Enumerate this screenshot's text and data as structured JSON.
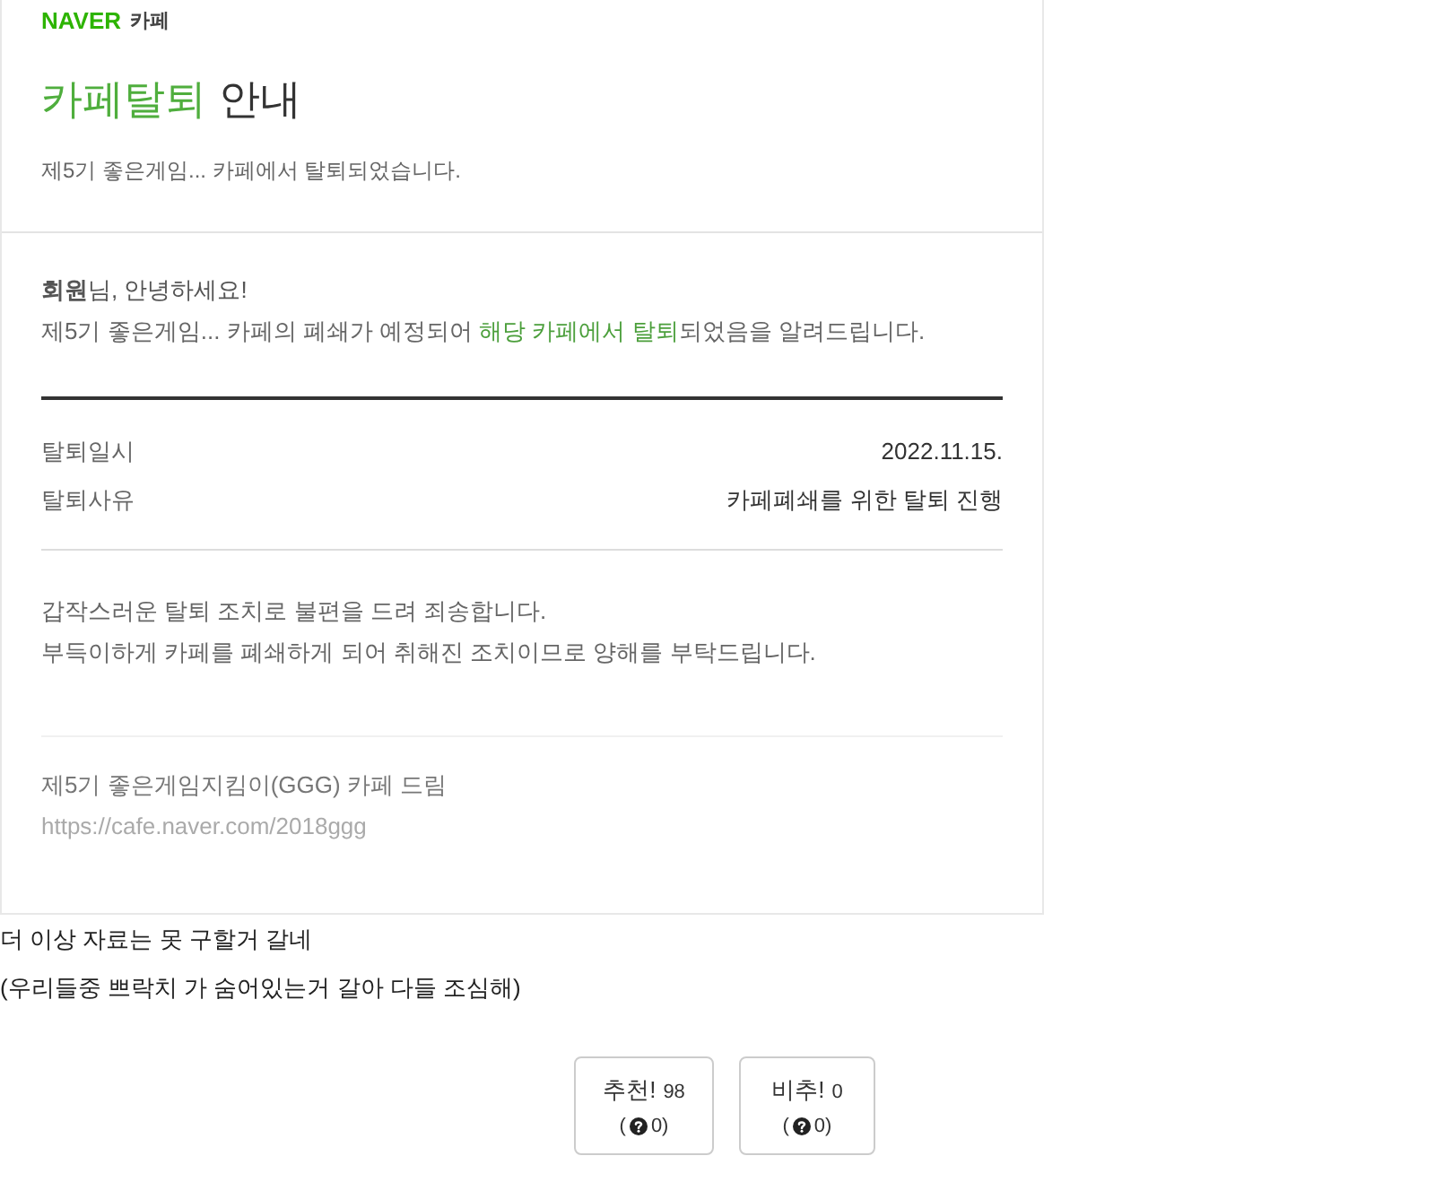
{
  "notice": {
    "logo": {
      "brand": "NAVER",
      "service": "카페"
    },
    "title": {
      "highlight": "카페탈퇴",
      "rest": "안내"
    },
    "summary": "제5기 좋은게임... 카페에서 탈퇴되었습니다.",
    "greeting": "**회원**님, 안녕하세요!",
    "message": [
      {
        "text": "제5기 좋은게임... 카페의 폐쇄가 예정되어 ",
        "highlight": false
      },
      {
        "text": "해당 카페에서 탈퇴",
        "highlight": true
      },
      {
        "text": "되었음을 알려드립니다.",
        "highlight": false
      }
    ],
    "details": [
      {
        "label": "탈퇴일시",
        "value": "2022.11.15."
      },
      {
        "label": "탈퇴사유",
        "value": "카페폐쇄를 위한 탈퇴 진행"
      }
    ],
    "apology": [
      "갑작스러운 탈퇴 조치로 불편을 드려 죄송합니다.",
      "부득이하게 카페를 폐쇄하게 되어 취해진 조치이므로 양해를 부탁드립니다."
    ],
    "signature": "제5기 좋은게임지킴이(GGG) 카페 드림",
    "url": "https://cafe.naver.com/2018ggg"
  },
  "post": {
    "lines": [
      "더 이상 자료는 못 구할거 갈네",
      "(우리들중 쁘락치 가 숨어있는거 갈아 다들 조심해)"
    ]
  },
  "votes": [
    {
      "label": "추천!",
      "count": "98",
      "detail_before": "(",
      "detail_after": "0)"
    },
    {
      "label": "비추!",
      "count": "0",
      "detail_before": "(",
      "detail_after": "0)"
    }
  ]
}
